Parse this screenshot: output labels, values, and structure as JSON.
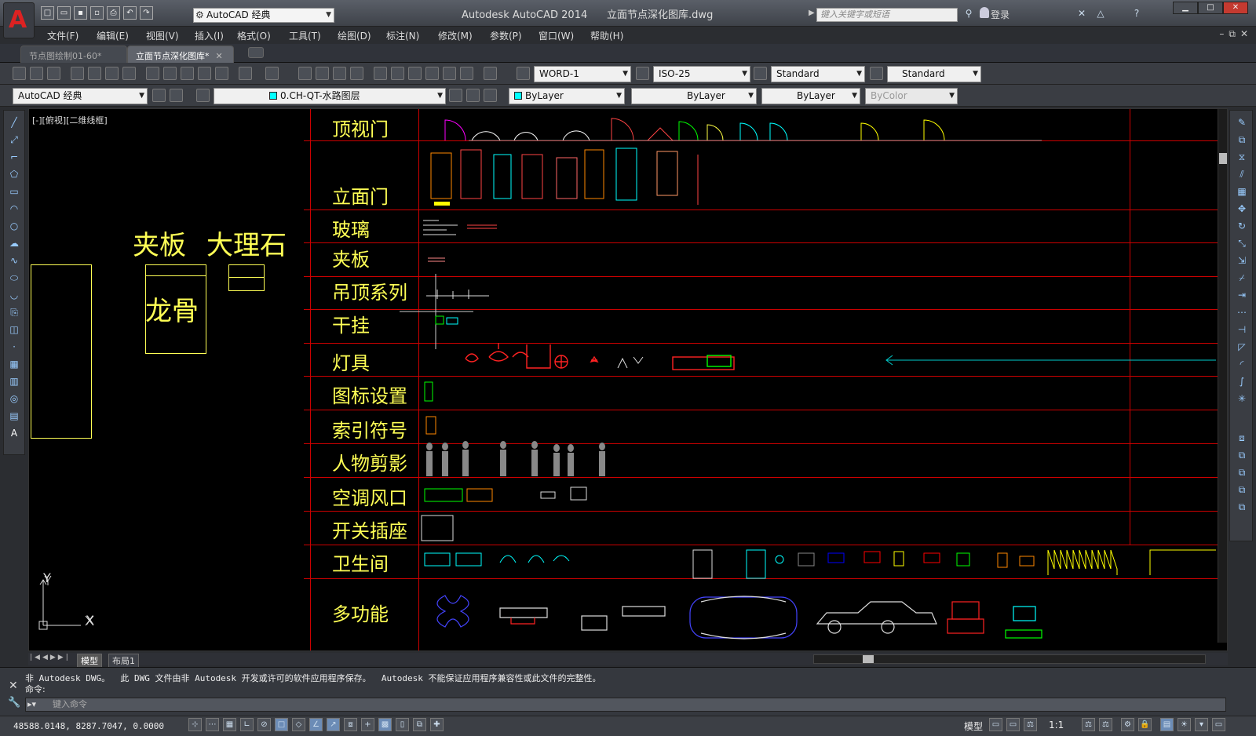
{
  "app": {
    "title": "Autodesk AutoCAD 2014",
    "filename": "立面节点深化图库.dwg",
    "workspace": "AutoCAD 经典",
    "search_placeholder": "键入关键字或短语",
    "signin": "登录",
    "brand_color": "#d22222"
  },
  "menu": [
    "文件(F)",
    "编辑(E)",
    "视图(V)",
    "插入(I)",
    "格式(O)",
    "工具(T)",
    "绘图(D)",
    "标注(N)",
    "修改(M)",
    "参数(P)",
    "窗口(W)",
    "帮助(H)"
  ],
  "tabs": [
    {
      "label": "节点图绘制01-60*",
      "active": false
    },
    {
      "label": "立面节点深化图库*",
      "active": true
    }
  ],
  "toolbar": {
    "text_style": "WORD-1",
    "dim_style": "ISO-25",
    "table_style": "Standard",
    "mleader_style": "Standard",
    "workspace": "AutoCAD 经典",
    "layer": "0.CH-QT-水路图层",
    "color": "ByLayer",
    "linetype": "ByLayer",
    "lineweight": "ByLayer",
    "plotstyle": "ByColor"
  },
  "canvas": {
    "viewport_label": "[-][俯视][二维线框]",
    "rows": [
      "顶视门",
      "立面门",
      "玻璃",
      "夹板",
      "吊顶系列",
      "干挂",
      "灯具",
      "图标设置",
      "索引符号",
      "人物剪影",
      "空调风口",
      "开关插座",
      "卫生间",
      "多功能"
    ],
    "left_labels": {
      "plywood": "夹板",
      "marble": "大理石",
      "keel": "龙骨"
    },
    "ucs_x": "X",
    "ucs_y": "Y",
    "colors": {
      "label": "#ffff55",
      "grid_line": "#cc0000",
      "background": "#000000"
    }
  },
  "layout_tabs": [
    "模型",
    "布局1"
  ],
  "command": {
    "history": "非 Autodesk DWG。  此 DWG 文件由非 Autodesk 开发或许可的软件应用程序保存。  Autodesk 不能保证应用程序兼容性或此文件的完整性。",
    "prompt_line": "命令:",
    "placeholder": "键入命令"
  },
  "status": {
    "coords": "48588.0148, 8287.7047, 0.0000",
    "model": "模型",
    "scale": "1:1"
  }
}
